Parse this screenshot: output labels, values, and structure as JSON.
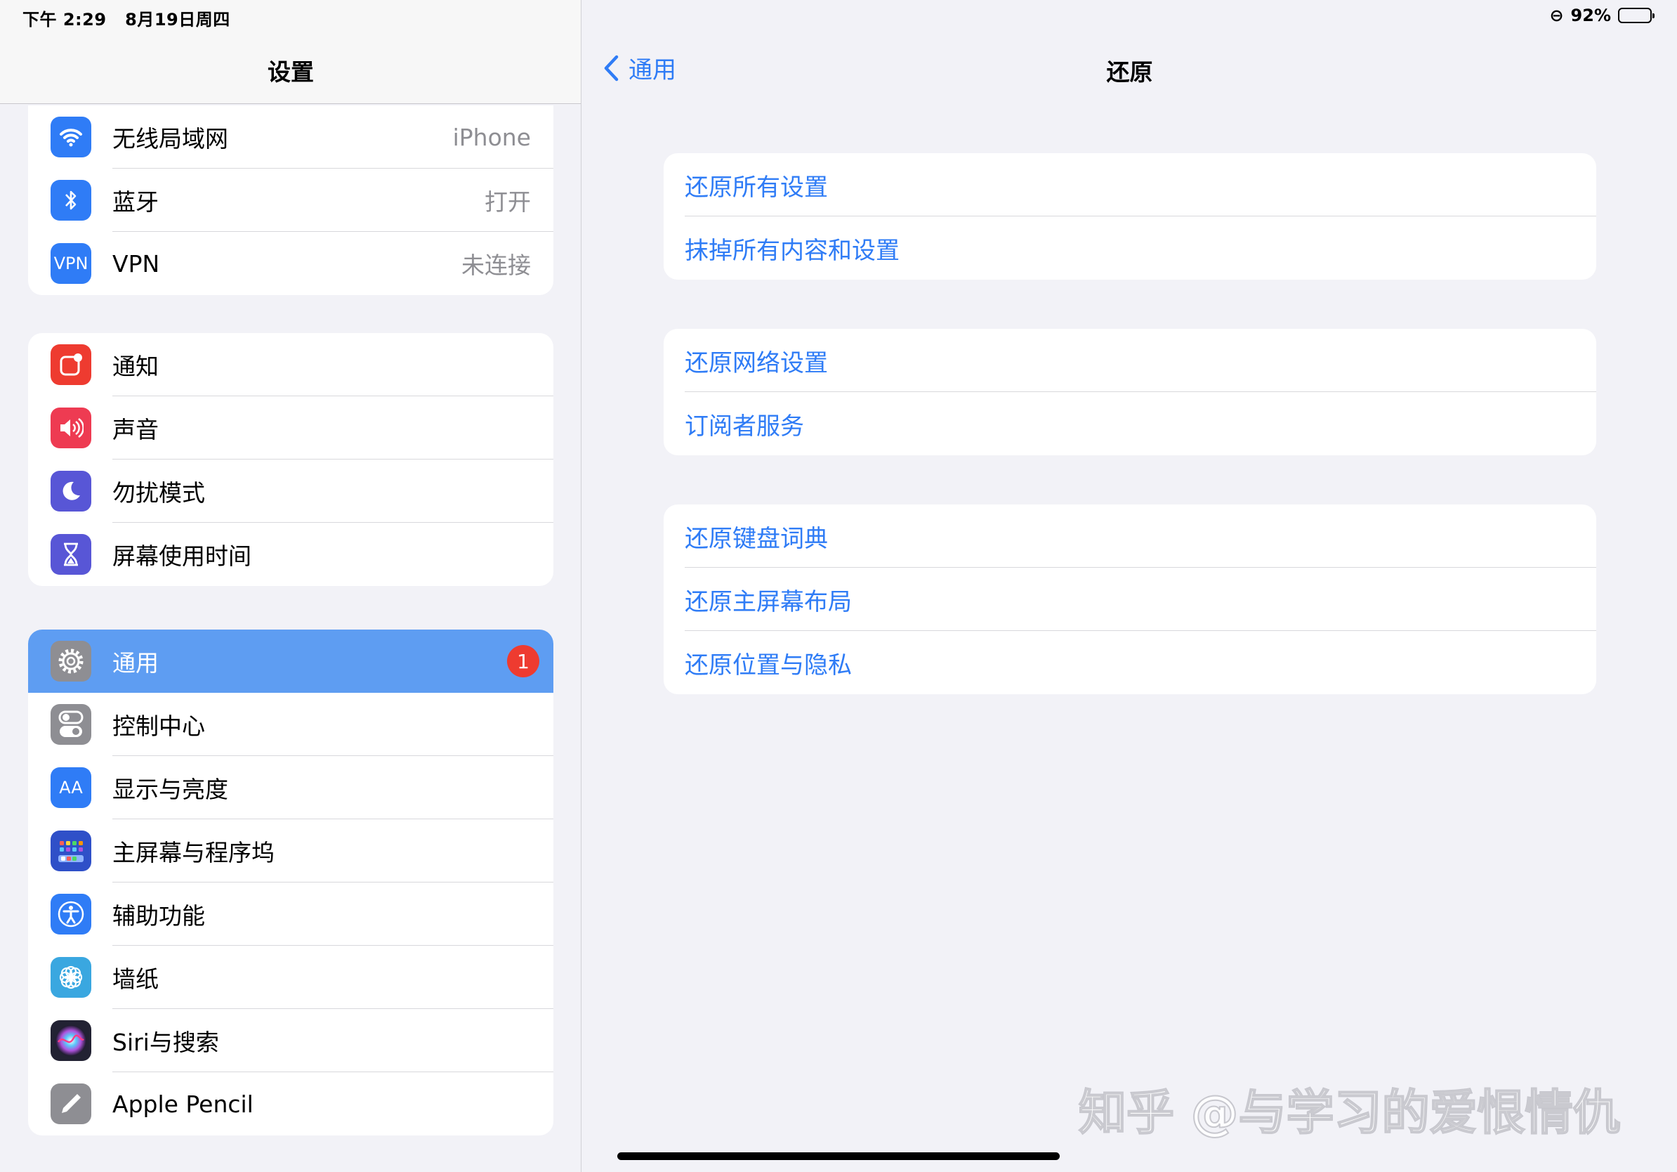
{
  "status": {
    "time": "下午 2:29",
    "date": "8月19日周四",
    "battery": "92%",
    "battery_level": 0.92
  },
  "sidebar": {
    "title": "设置",
    "groups": [
      {
        "items": [
          {
            "label": "无线局域网",
            "value": "iPhone",
            "icon": "wifi-icon",
            "color": "#2f7cf6"
          },
          {
            "label": "蓝牙",
            "value": "打开",
            "icon": "bluetooth-icon",
            "color": "#2f7cf6"
          },
          {
            "label": "VPN",
            "value": "未连接",
            "icon": "vpn-icon",
            "icon_text": "VPN",
            "color": "#2f7cf6"
          }
        ]
      },
      {
        "items": [
          {
            "label": "通知",
            "icon": "notifications-icon",
            "color": "#ee3b30"
          },
          {
            "label": "声音",
            "icon": "sound-icon",
            "color": "#ee3b52"
          },
          {
            "label": "勿扰模式",
            "icon": "moon-icon",
            "color": "#5856d6"
          },
          {
            "label": "屏幕使用时间",
            "icon": "hourglass-icon",
            "color": "#5856d6"
          }
        ]
      },
      {
        "items": [
          {
            "label": "通用",
            "icon": "gear-icon",
            "color": "#8e8e93",
            "selected": true,
            "badge": "1"
          },
          {
            "label": "控制中心",
            "icon": "toggles-icon",
            "color": "#8e8e93"
          },
          {
            "label": "显示与亮度",
            "icon": "display-icon",
            "icon_text": "AA",
            "color": "#2f7cf6"
          },
          {
            "label": "主屏幕与程序坞",
            "icon": "home-screen-icon",
            "color": "#2f50c8"
          },
          {
            "label": "辅助功能",
            "icon": "accessibility-icon",
            "color": "#2f7cf6"
          },
          {
            "label": "墙纸",
            "icon": "wallpaper-icon",
            "color": "#3aa7e0"
          },
          {
            "label": "Siri与搜索",
            "icon": "siri-icon",
            "color": "#222233"
          },
          {
            "label": "Apple Pencil",
            "icon": "pencil-icon",
            "color": "#8e8e93"
          }
        ]
      }
    ]
  },
  "detail": {
    "back_label": "通用",
    "title": "还原",
    "groups": [
      [
        "还原所有设置",
        "抹掉所有内容和设置"
      ],
      [
        "还原网络设置",
        "订阅者服务"
      ],
      [
        "还原键盘词典",
        "还原主屏幕布局",
        "还原位置与隐私"
      ]
    ]
  },
  "watermark": "知乎 @与学习的爱恨情仇"
}
